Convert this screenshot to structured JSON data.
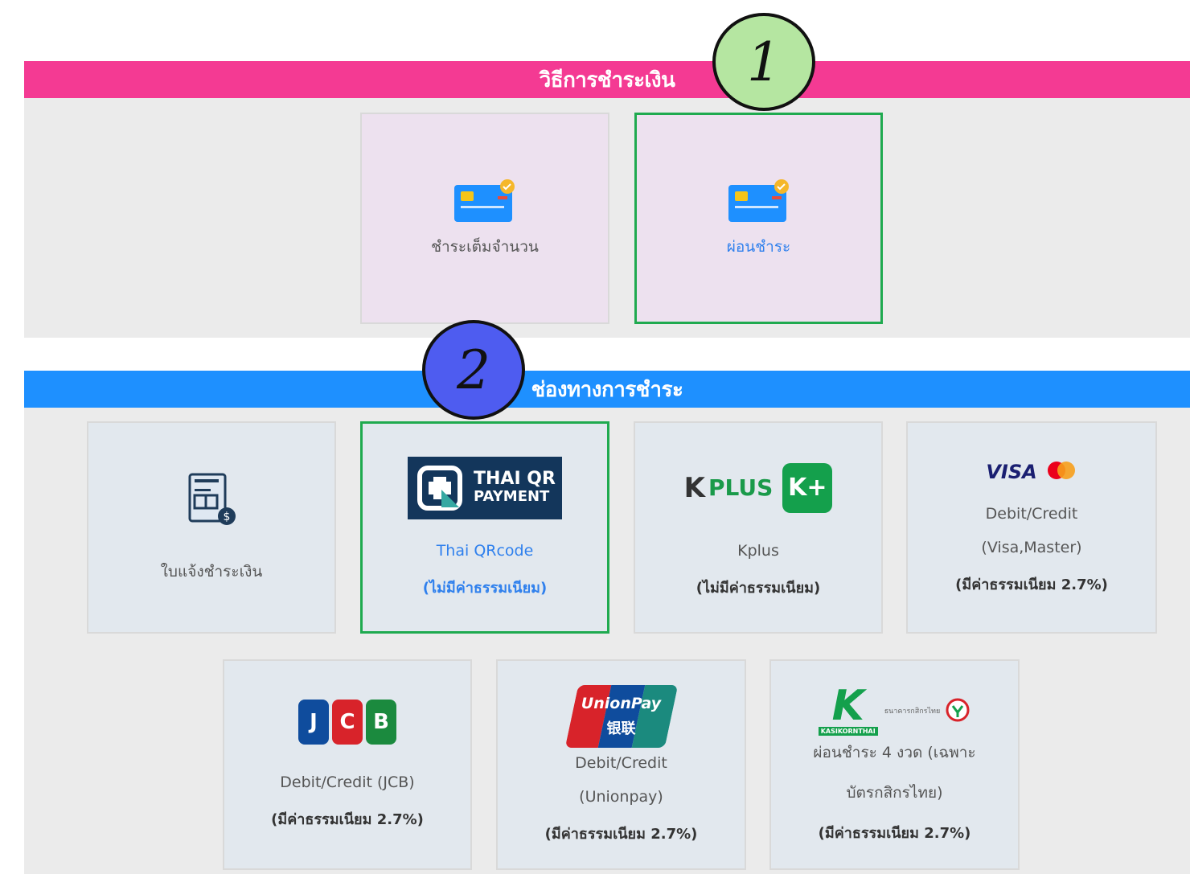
{
  "sections": {
    "payment_method_title": "วิธีการชำระเงิน",
    "payment_channel_title": "ช่องทางการชำระ"
  },
  "markers": {
    "one": "1",
    "two": "2"
  },
  "methods": [
    {
      "label": "ชำระเต็มจำนวน",
      "selected": false
    },
    {
      "label": "ผ่อนชำระ",
      "selected": true
    }
  ],
  "channels": {
    "invoice": {
      "label": "ใบแจ้งชำระเงิน"
    },
    "thaiqr": {
      "logo_line1": "THAI QR",
      "logo_line2": "PAYMENT",
      "label": "Thai QRcode",
      "fee": "(ไม่มีค่าธรรมเนียม)",
      "selected": true
    },
    "kplus": {
      "logo_text": "PLUS",
      "logo_badge": "K+",
      "label": "Kplus",
      "fee": "(ไม่มีค่าธรรมเนียม)"
    },
    "visa": {
      "logo_text": "VISA",
      "label": "Debit/Credit",
      "detail": "(Visa,Master)",
      "fee": "(มีค่าธรรมเนียม 2.7%)"
    },
    "jcb": {
      "logo_text": "JCB",
      "label": "Debit/Credit (JCB)",
      "fee": "(มีค่าธรรมเนียม 2.7%)"
    },
    "unionpay": {
      "logo_line1": "UnionPay",
      "logo_line2": "银联",
      "label": "Debit/Credit",
      "detail": "(Unionpay)",
      "fee": "(มีค่าธรรมเนียม 2.7%)"
    },
    "kasikorn": {
      "logo_badge": "KASIKORNTHAI",
      "logo_thai": "ธนาคารกสิกรไทย",
      "label": "ผ่อนชำระ 4 งวด (เฉพาะ",
      "detail": "บัตรกสิกรไทย)",
      "fee": "(มีค่าธรรมเนียม 2.7%)"
    }
  },
  "colors": {
    "pink_band": "#f43a93",
    "blue_band": "#1e90ff",
    "selected_border": "#1faa4f",
    "link_blue": "#2f80ed"
  }
}
